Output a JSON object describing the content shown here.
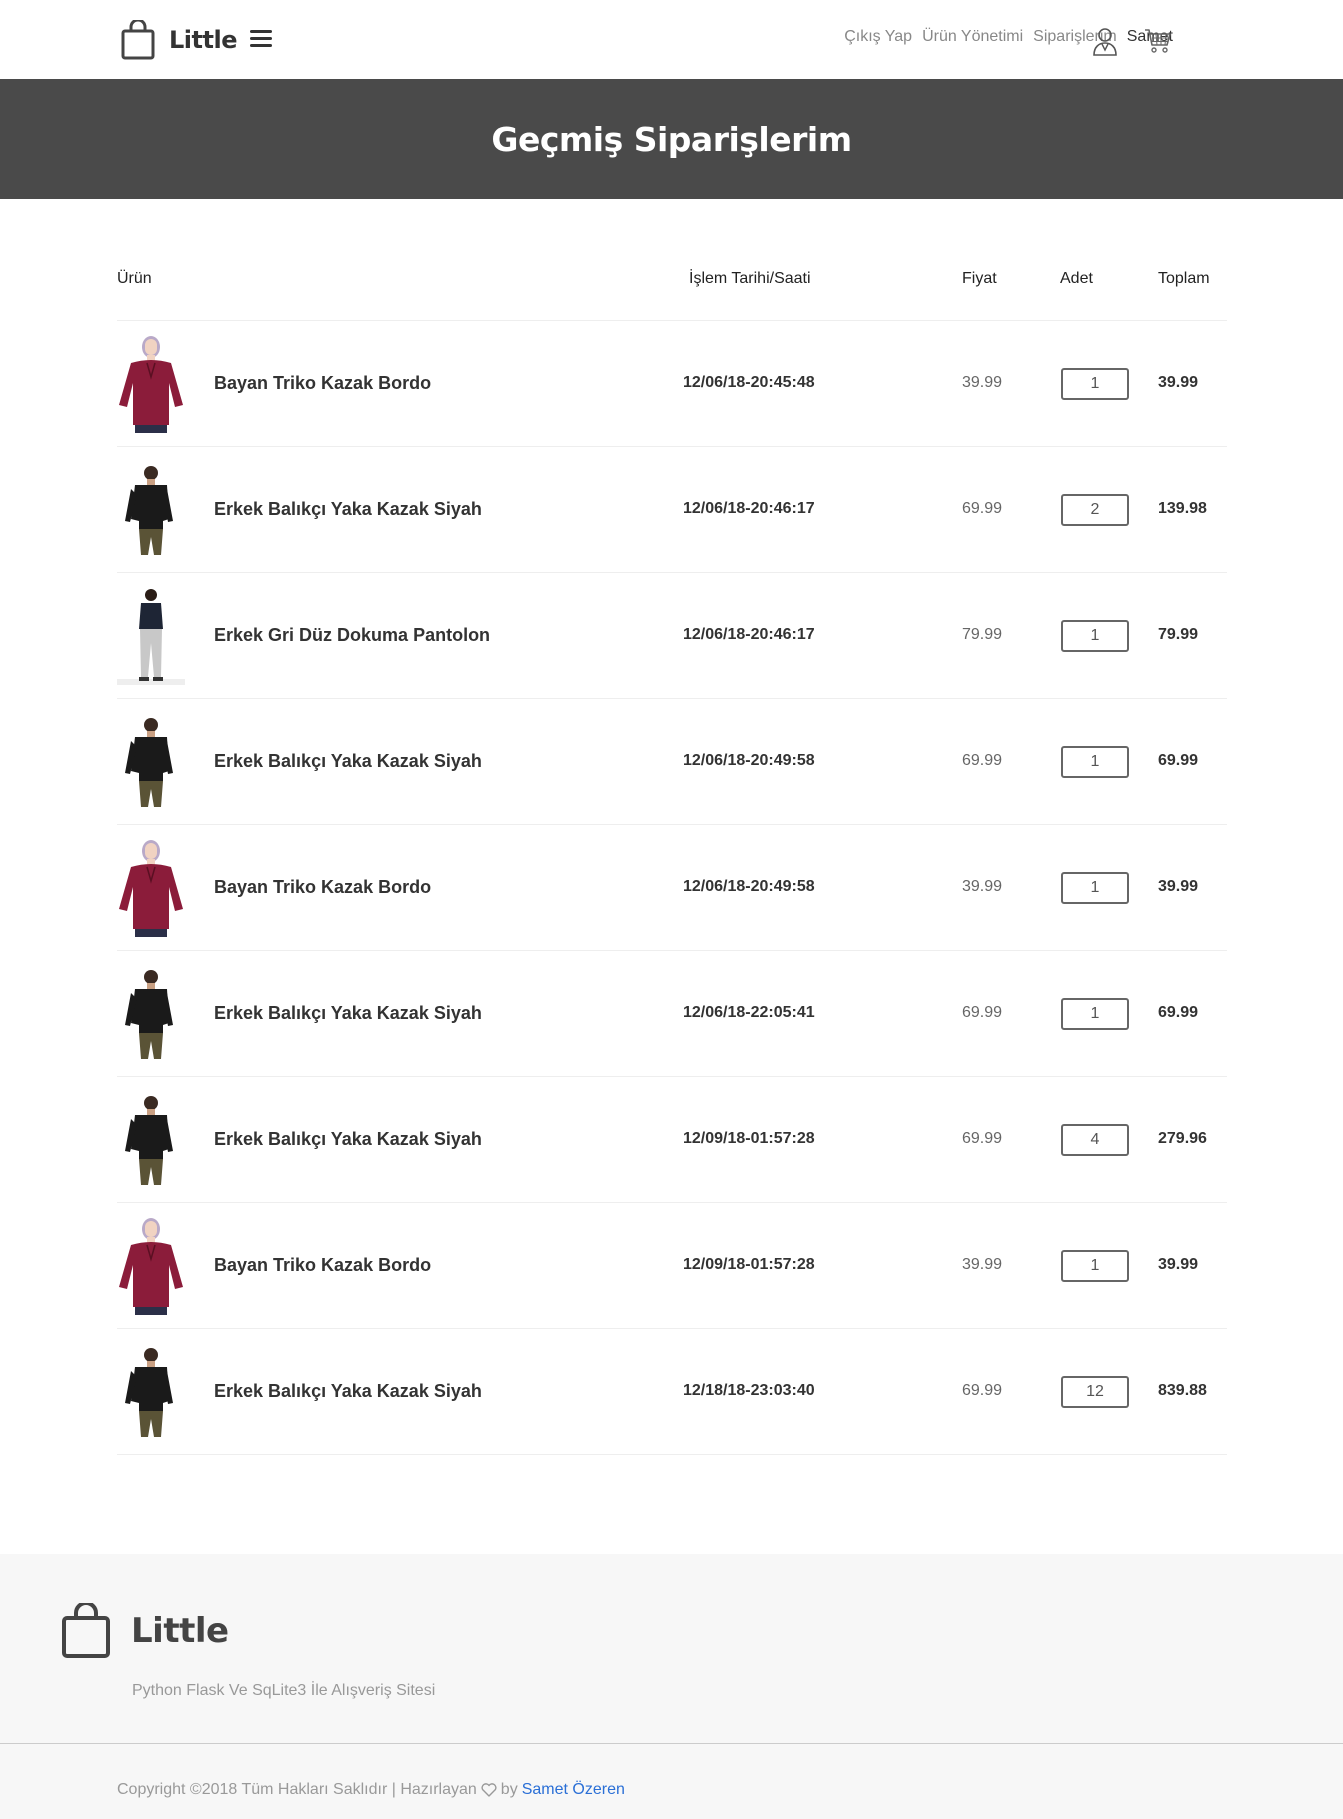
{
  "header": {
    "logo_text": "Little",
    "nav": {
      "logout": "Çıkış Yap",
      "product_management": "Ürün Yönetimi",
      "my_orders": "Siparişlerim",
      "user_name": "Samet"
    }
  },
  "banner": {
    "title": "Geçmiş Siparişlerim"
  },
  "table": {
    "headers": {
      "product": "Ürün",
      "datetime": "İşlem Tarihi/Saati",
      "price": "Fiyat",
      "qty": "Adet",
      "total": "Toplam"
    },
    "rows": [
      {
        "image": "bordo-kazak",
        "name": "Bayan Triko Kazak Bordo",
        "date": "12/06/18-20:45:48",
        "price": "39.99",
        "qty": "1",
        "total": "39.99"
      },
      {
        "image": "siyah-kazak",
        "name": "Erkek Balıkçı Yaka Kazak Siyah",
        "date": "12/06/18-20:46:17",
        "price": "69.99",
        "qty": "2",
        "total": "139.98"
      },
      {
        "image": "gri-pantolon",
        "name": "Erkek Gri Düz Dokuma Pantolon",
        "date": "12/06/18-20:46:17",
        "price": "79.99",
        "qty": "1",
        "total": "79.99"
      },
      {
        "image": "siyah-kazak",
        "name": "Erkek Balıkçı Yaka Kazak Siyah",
        "date": "12/06/18-20:49:58",
        "price": "69.99",
        "qty": "1",
        "total": "69.99"
      },
      {
        "image": "bordo-kazak",
        "name": "Bayan Triko Kazak Bordo",
        "date": "12/06/18-20:49:58",
        "price": "39.99",
        "qty": "1",
        "total": "39.99"
      },
      {
        "image": "siyah-kazak",
        "name": "Erkek Balıkçı Yaka Kazak Siyah",
        "date": "12/06/18-22:05:41",
        "price": "69.99",
        "qty": "1",
        "total": "69.99"
      },
      {
        "image": "siyah-kazak",
        "name": "Erkek Balıkçı Yaka Kazak Siyah",
        "date": "12/09/18-01:57:28",
        "price": "69.99",
        "qty": "4",
        "total": "279.96"
      },
      {
        "image": "bordo-kazak",
        "name": "Bayan Triko Kazak Bordo",
        "date": "12/09/18-01:57:28",
        "price": "39.99",
        "qty": "1",
        "total": "39.99"
      },
      {
        "image": "siyah-kazak",
        "name": "Erkek Balıkçı Yaka Kazak Siyah",
        "date": "12/18/18-23:03:40",
        "price": "69.99",
        "qty": "12",
        "total": "839.88"
      }
    ]
  },
  "footer": {
    "logo_text": "Little",
    "tagline": "Python Flask Ve SqLite3 İle Alışveriş Sitesi",
    "copyright_prefix": "Copyright ©2018 Tüm Hakları Saklıdır | Hazırlayan",
    "by": "by",
    "author": "Samet Özeren"
  },
  "colors": {
    "banner_bg": "#4a4a4a",
    "footer_bg": "#f7f7f7",
    "link_blue": "#2a6fd6",
    "bordo": "#8b1c3a",
    "dark_sweater": "#1a1a1a",
    "olive_pants": "#5a5336",
    "grey_pants": "#c8c8c8"
  },
  "icons": [
    "shopping-bag-icon",
    "hamburger-icon",
    "user-icon",
    "cart-icon",
    "heart-icon"
  ]
}
